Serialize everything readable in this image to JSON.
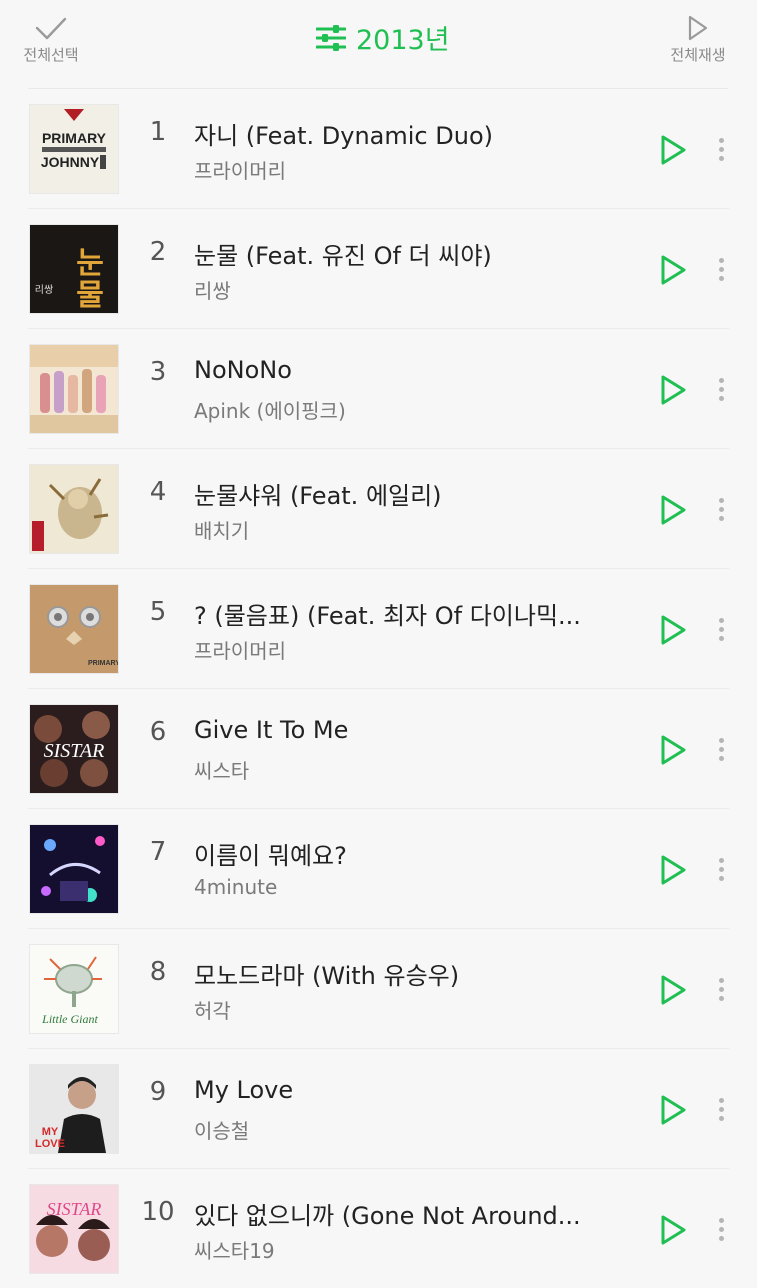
{
  "header": {
    "select_all_label": "전체선택",
    "play_all_label": "전체재생",
    "year_label": "2013년",
    "accent_color": "#1fbf52"
  },
  "tracks": [
    {
      "rank": "1",
      "title": "자니 (Feat. Dynamic Duo)",
      "artist": "프라이머리",
      "cover_text": "PRIMARY JOHNNY"
    },
    {
      "rank": "2",
      "title": "눈물 (Feat. 유진 Of 더 씨야)",
      "artist": "리쌍",
      "cover_text": "눈물"
    },
    {
      "rank": "3",
      "title": "NoNoNo",
      "artist": "Apink (에이핑크)",
      "cover_text": ""
    },
    {
      "rank": "4",
      "title": "눈물샤워 (Feat. 에일리)",
      "artist": "배치기",
      "cover_text": ""
    },
    {
      "rank": "5",
      "title": "? (물음표) (Feat. 최자 Of 다이나믹...",
      "artist": "프라이머리",
      "cover_text": "PRIMARY"
    },
    {
      "rank": "6",
      "title": "Give It To Me",
      "artist": "씨스타",
      "cover_text": "SISTAR"
    },
    {
      "rank": "7",
      "title": "이름이 뭐예요?",
      "artist": "4minute",
      "cover_text": ""
    },
    {
      "rank": "8",
      "title": "모노드라마 (With 유승우)",
      "artist": "허각",
      "cover_text": "Little Giant"
    },
    {
      "rank": "9",
      "title": "My Love",
      "artist": "이승철",
      "cover_text": "MY LOVE"
    },
    {
      "rank": "10",
      "title": "있다 없으니까 (Gone Not Around...",
      "artist": "씨스타19",
      "cover_text": "SISTAR"
    }
  ],
  "icons": {
    "select_all": "check-icon",
    "play_all": "play-outline-icon",
    "filter": "sliders-icon",
    "play": "play-icon",
    "more": "more-vertical-icon"
  }
}
